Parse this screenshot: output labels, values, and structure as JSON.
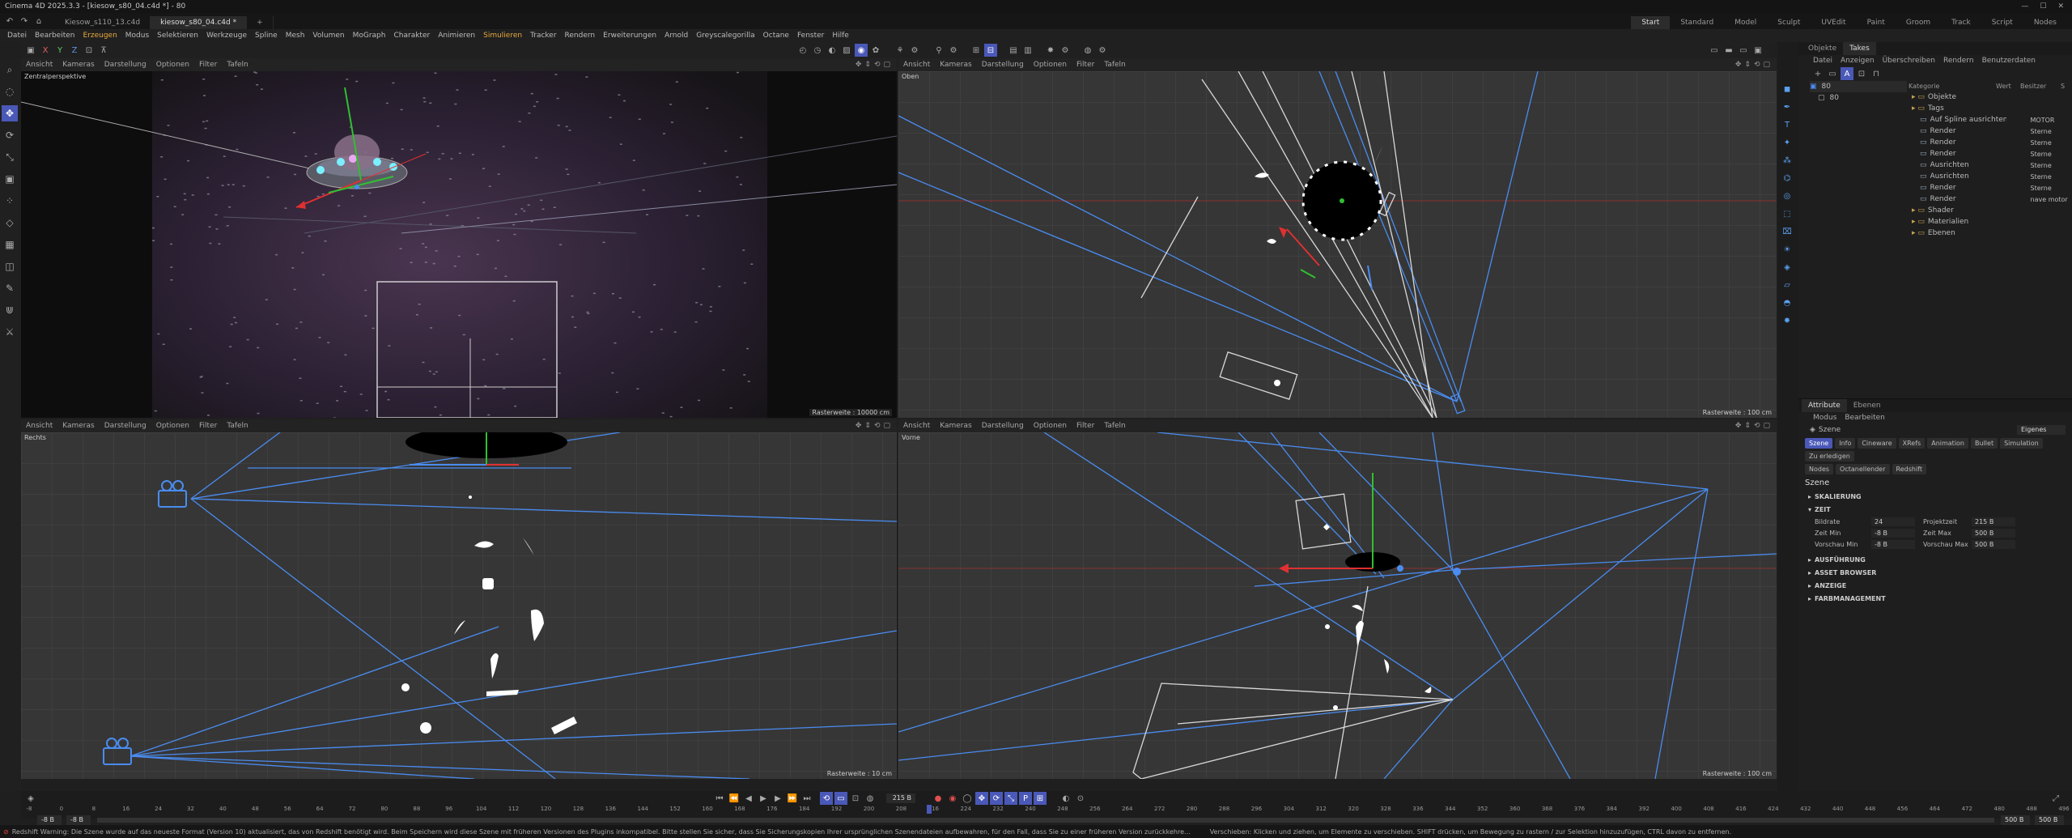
{
  "window": {
    "title": "Cinema 4D 2025.3.3 - [kiesow_s80_04.c4d *] - 80"
  },
  "doc_tabs": [
    {
      "label": "Kiesow_s110_13.c4d",
      "active": false
    },
    {
      "label": "kiesow_s80_04.c4d *",
      "active": true
    },
    {
      "label": "+",
      "active": false
    }
  ],
  "layouts": [
    "Start",
    "Standard",
    "Model",
    "Sculpt",
    "UVEdit",
    "Paint",
    "Groom",
    "Track",
    "Script",
    "Nodes"
  ],
  "menu": [
    "Datei",
    "Bearbeiten",
    "Erzeugen",
    "Modus",
    "Selektieren",
    "Werkzeuge",
    "Spline",
    "Mesh",
    "Volumen",
    "MoGraph",
    "Charakter",
    "Animieren",
    "Simulieren",
    "Tracker",
    "Rendern",
    "Erweiterungen",
    "Arnold",
    "Greyscalegorilla",
    "Octane",
    "Fenster",
    "Hilfe"
  ],
  "menu_highlight": [
    "Erzeugen",
    "Simulieren"
  ],
  "viewport_menu": [
    "Ansicht",
    "Kameras",
    "Darstellung",
    "Optionen",
    "Filter",
    "Tafeln"
  ],
  "viewports": {
    "perspective": {
      "name": "Zentralperspektive",
      "scale": "Rasterweite : 10000 cm"
    },
    "top": {
      "name": "Oben",
      "scale": "Rasterweite : 100 cm"
    },
    "right": {
      "name": "Rechts",
      "scale": "Rasterweite : 10 cm"
    },
    "front": {
      "name": "Vorne",
      "scale": "Rasterweite : 100 cm"
    }
  },
  "objects_panel": {
    "tabs": [
      "Objekte",
      "Takes"
    ],
    "menu": [
      "Datei",
      "Anzeigen",
      "Überschreiben",
      "Rendern",
      "Benutzerdaten"
    ],
    "takes": [
      {
        "label": "80"
      },
      {
        "label": "80"
      }
    ],
    "columns": [
      "Kategorie",
      "Wert",
      "Besitzer",
      "S"
    ],
    "tree": [
      {
        "label": "Objekte",
        "value": "",
        "depth": 0
      },
      {
        "label": "Tags",
        "value": "",
        "depth": 0
      },
      {
        "label": "Auf Spline ausrichten",
        "value": "MOTOR",
        "depth": 1
      },
      {
        "label": "Render",
        "value": "Sterne",
        "depth": 1
      },
      {
        "label": "Render",
        "value": "Sterne",
        "depth": 1
      },
      {
        "label": "Render",
        "value": "Sterne",
        "depth": 1
      },
      {
        "label": "Ausrichten",
        "value": "Sterne",
        "depth": 1
      },
      {
        "label": "Ausrichten",
        "value": "Sterne",
        "depth": 1
      },
      {
        "label": "Render",
        "value": "Sterne",
        "depth": 1
      },
      {
        "label": "Render",
        "value": "nave motor",
        "depth": 1
      },
      {
        "label": "Shader",
        "value": "",
        "depth": 0
      },
      {
        "label": "Materialien",
        "value": "",
        "depth": 0
      },
      {
        "label": "Ebenen",
        "value": "",
        "depth": 0
      }
    ]
  },
  "attributes_panel": {
    "tabs": [
      "Attribute",
      "Ebenen"
    ],
    "menu": [
      "Modus",
      "Bearbeiten"
    ],
    "object": "Szene",
    "preset": "Eigenes",
    "pills_row1": [
      {
        "label": "Szene",
        "active": true
      },
      {
        "label": "Info",
        "active": false
      },
      {
        "label": "Cineware",
        "active": false
      },
      {
        "label": "XRefs",
        "active": false
      },
      {
        "label": "Animation",
        "active": false
      },
      {
        "label": "Bullet",
        "active": false
      },
      {
        "label": "Simulation",
        "active": false
      },
      {
        "label": "Zu erledigen",
        "active": false
      }
    ],
    "pills_row2": [
      {
        "label": "Nodes",
        "active": false
      },
      {
        "label": "Octanellender",
        "active": false
      },
      {
        "label": "Redshift",
        "active": false
      }
    ],
    "heading": "Szene",
    "sections_top": [
      "SKALIERUNG"
    ],
    "zeit_title": "ZEIT",
    "fields": [
      {
        "label": "Bildrate",
        "value": "24",
        "label2": "Projektzeit",
        "value2": "215 B"
      },
      {
        "label": "Zeit Min",
        "value": "-8 B",
        "label2": "Zeit Max",
        "value2": "500 B"
      },
      {
        "label": "Vorschau Min",
        "value": "-8 B",
        "label2": "Vorschau Max",
        "value2": "500 B"
      }
    ],
    "sections_bottom": [
      "AUSFÜHRUNG",
      "ASSET BROWSER",
      "ANZEIGE",
      "FARBMANAGEMENT"
    ]
  },
  "timeline": {
    "frame_field": "215 B",
    "ticks": [
      "-8",
      "0",
      "8",
      "16",
      "24",
      "32",
      "40",
      "48",
      "56",
      "64",
      "72",
      "80",
      "88",
      "96",
      "104",
      "112",
      "120",
      "128",
      "136",
      "144",
      "152",
      "160",
      "168",
      "176",
      "184",
      "192",
      "200",
      "208",
      "216",
      "224",
      "232",
      "240",
      "248",
      "256",
      "264",
      "272",
      "280",
      "288",
      "296",
      "304",
      "312",
      "320",
      "328",
      "336",
      "344",
      "352",
      "360",
      "368",
      "376",
      "384",
      "392",
      "400",
      "408",
      "416",
      "424",
      "432",
      "440",
      "448",
      "456",
      "464",
      "472",
      "480",
      "488",
      "496"
    ],
    "range_start": "-8 B",
    "range_start2": "-8 B",
    "range_end": "500 B",
    "range_end2": "500 B"
  },
  "statusbar": {
    "left": "Redshift Warning: Die Szene wurde auf das neueste Format (Version 10) aktualisiert, das von Redshift benötigt wird. Beim Speichern wird diese Szene mit früheren Versionen des Plugins inkompatibel. Bitte stellen Sie sicher, dass Sie Sicherungskopien Ihrer ursprünglichen Szenendateien aufbewahren, für den Fall, dass Sie zu einer früheren Version zurückkehren müssen. Pfad: Z:\\Projekte Daniel\\wechsel\\2018\\11_WF_Kiesow\\3D\\Kiesow_s80_04\\kiesow_s80_04.c4d",
    "right": "Verschieben: Klicken und ziehen, um Elemente zu verschieben. SHIFT drücken, um Bewegung zu rastern / zur Selektion hinzuzufügen, CTRL davon zu entfernen."
  },
  "icons": {
    "sidebar": [
      "search-icon",
      "live-selection-icon",
      "move-icon",
      "rotate-icon",
      "scale-icon",
      "model-mode-icon",
      "points-mode-icon",
      "edges-mode-icon",
      "polygons-mode-icon",
      "uv-mode-icon",
      "brush-icon",
      "magnet-icon",
      "knife-icon"
    ],
    "right_strip": [
      "cube-icon",
      "spline-pen-icon",
      "text-icon",
      "generator-icon",
      "cloner-icon",
      "deformer-icon",
      "field-icon",
      "tag-icon",
      "camera-icon",
      "light-icon",
      "scene-icon",
      "floor-icon",
      "sky-icon",
      "render-icon"
    ]
  },
  "colors": {
    "accent": "#4a58b8",
    "menu_highlight": "#e8a83c",
    "camera_blue": "#4a8cf0"
  }
}
